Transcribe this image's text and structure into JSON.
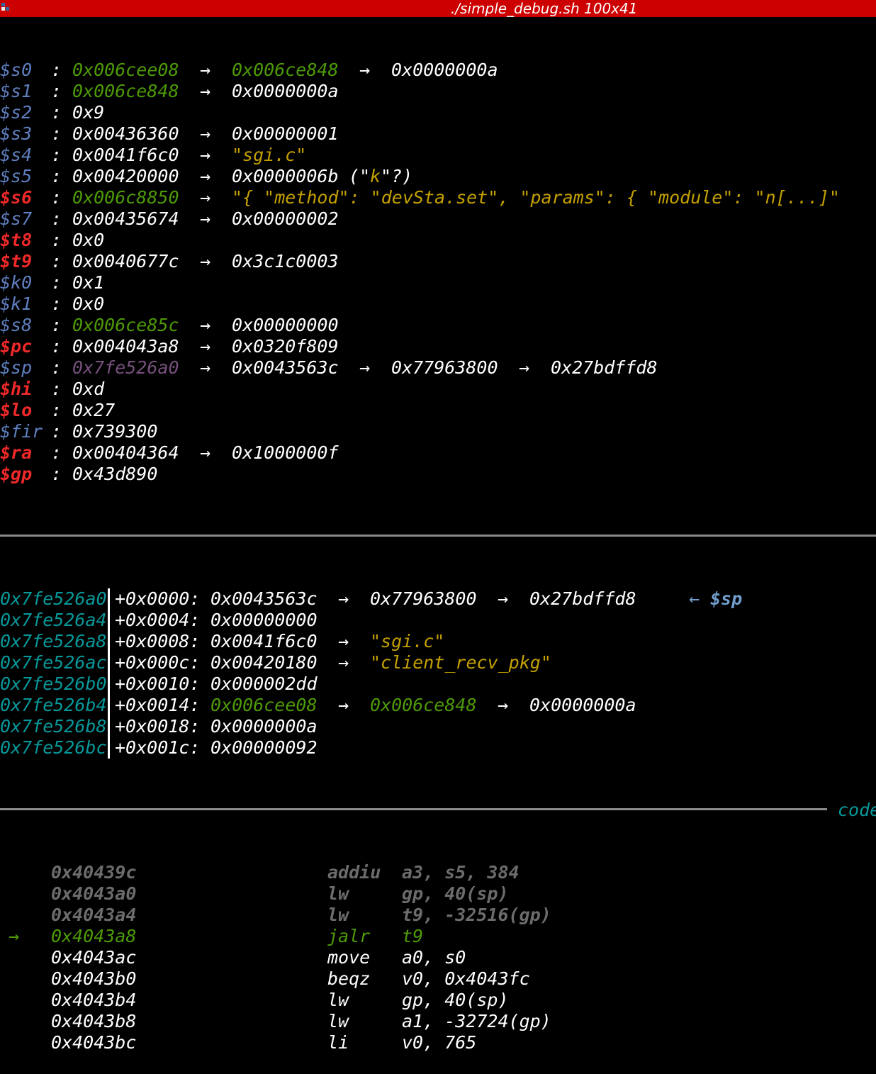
{
  "window": {
    "title": "./simple_debug.sh 100x41"
  },
  "colors": {
    "titlebar": "#cc0000",
    "reg_normal": "#5f7fbf",
    "reg_changed": "#ef2929",
    "value_white": "#ffffff",
    "value_heap": "#4e9a06",
    "value_stack": "#75507b",
    "string": "#c4a000",
    "stack_addr": "#06989a",
    "sep_line": "#8a8a8a",
    "code_past": "#6c6c6c",
    "code_current": "#4e9a06",
    "sp_marker": "#729fcf"
  },
  "registers": [
    {
      "name": "$s0",
      "changed": false,
      "chain": [
        {
          "text": "0x006cee08",
          "color": "heap"
        },
        {
          "text": "0x006ce848",
          "color": "heap"
        },
        {
          "text": "0x0000000a",
          "color": "white"
        }
      ]
    },
    {
      "name": "$s1",
      "changed": false,
      "chain": [
        {
          "text": "0x006ce848",
          "color": "heap"
        },
        {
          "text": "0x0000000a",
          "color": "white"
        }
      ]
    },
    {
      "name": "$s2",
      "changed": false,
      "chain": [
        {
          "text": "0x9",
          "color": "white"
        }
      ]
    },
    {
      "name": "$s3",
      "changed": false,
      "chain": [
        {
          "text": "0x00436360",
          "color": "white"
        },
        {
          "text": "0x00000001",
          "color": "white"
        }
      ]
    },
    {
      "name": "$s4",
      "changed": false,
      "chain": [
        {
          "text": "0x0041f6c0",
          "color": "white"
        },
        {
          "text": "\"sgi.c\"",
          "color": "string"
        }
      ]
    },
    {
      "name": "$s5",
      "changed": false,
      "chain": [
        {
          "text": "0x00420000",
          "color": "white"
        },
        {
          "text": "0x0000006b",
          "color": "white"
        }
      ],
      "suffix": [
        {
          "text": " (\"",
          "color": "white"
        },
        {
          "text": "k",
          "color": "string"
        },
        {
          "text": "\"?)",
          "color": "white"
        }
      ]
    },
    {
      "name": "$s6",
      "changed": true,
      "chain": [
        {
          "text": "0x006c8850",
          "color": "heap"
        },
        {
          "text": "\"{ \"method\": \"devSta.set\", \"params\": { \"module\": \"n[...]\"",
          "color": "string"
        }
      ]
    },
    {
      "name": "$s7",
      "changed": false,
      "chain": [
        {
          "text": "0x00435674",
          "color": "white"
        },
        {
          "text": "0x00000002",
          "color": "white"
        }
      ]
    },
    {
      "name": "$t8",
      "changed": true,
      "chain": [
        {
          "text": "0x0",
          "color": "white"
        }
      ]
    },
    {
      "name": "$t9",
      "changed": true,
      "chain": [
        {
          "text": "0x0040677c",
          "color": "white"
        },
        {
          "text": "0x3c1c0003",
          "color": "white"
        }
      ]
    },
    {
      "name": "$k0",
      "changed": false,
      "chain": [
        {
          "text": "0x1",
          "color": "white"
        }
      ]
    },
    {
      "name": "$k1",
      "changed": false,
      "chain": [
        {
          "text": "0x0",
          "color": "white"
        }
      ]
    },
    {
      "name": "$s8",
      "changed": false,
      "chain": [
        {
          "text": "0x006ce85c",
          "color": "heap"
        },
        {
          "text": "0x00000000",
          "color": "white"
        }
      ]
    },
    {
      "name": "$pc",
      "changed": true,
      "chain": [
        {
          "text": "0x004043a8",
          "color": "white"
        },
        {
          "text": "0x0320f809",
          "color": "white"
        }
      ]
    },
    {
      "name": "$sp",
      "changed": false,
      "chain": [
        {
          "text": "0x7fe526a0",
          "color": "stack"
        },
        {
          "text": "0x0043563c",
          "color": "white"
        },
        {
          "text": "0x77963800",
          "color": "white"
        },
        {
          "text": "0x27bdffd8",
          "color": "white"
        }
      ]
    },
    {
      "name": "$hi",
      "changed": true,
      "chain": [
        {
          "text": "0xd",
          "color": "white"
        }
      ]
    },
    {
      "name": "$lo",
      "changed": true,
      "chain": [
        {
          "text": "0x27",
          "color": "white"
        }
      ]
    },
    {
      "name": "$fir",
      "changed": false,
      "chain": [
        {
          "text": "0x739300",
          "color": "white"
        }
      ]
    },
    {
      "name": "$ra",
      "changed": true,
      "chain": [
        {
          "text": "0x00404364",
          "color": "white"
        },
        {
          "text": "0x1000000f",
          "color": "white"
        }
      ]
    },
    {
      "name": "$gp",
      "changed": true,
      "chain": [
        {
          "text": "0x43d890",
          "color": "white"
        }
      ]
    }
  ],
  "symbols": {
    "arrow": "→",
    "sep": ":",
    "back_arrow": "←"
  },
  "stack": {
    "rows": [
      {
        "addr": "0x7fe526a0",
        "offset": "+0x0000:",
        "chain": [
          {
            "text": "0x0043563c",
            "color": "white"
          },
          {
            "text": "0x77963800",
            "color": "white"
          },
          {
            "text": "0x27bdffd8",
            "color": "white"
          }
        ],
        "marker": "$sp"
      },
      {
        "addr": "0x7fe526a4",
        "offset": "+0x0004:",
        "chain": [
          {
            "text": "0x00000000",
            "color": "white"
          }
        ]
      },
      {
        "addr": "0x7fe526a8",
        "offset": "+0x0008:",
        "chain": [
          {
            "text": "0x0041f6c0",
            "color": "white"
          },
          {
            "text": "\"sgi.c\"",
            "color": "string"
          }
        ]
      },
      {
        "addr": "0x7fe526ac",
        "offset": "+0x000c:",
        "chain": [
          {
            "text": "0x00420180",
            "color": "white"
          },
          {
            "text": "\"client_recv_pkg\"",
            "color": "string"
          }
        ]
      },
      {
        "addr": "0x7fe526b0",
        "offset": "+0x0010:",
        "chain": [
          {
            "text": "0x000002dd",
            "color": "white"
          }
        ]
      },
      {
        "addr": "0x7fe526b4",
        "offset": "+0x0014:",
        "chain": [
          {
            "text": "0x006cee08",
            "color": "heap"
          },
          {
            "text": "0x006ce848",
            "color": "heap"
          },
          {
            "text": "0x0000000a",
            "color": "white"
          }
        ]
      },
      {
        "addr": "0x7fe526b8",
        "offset": "+0x0018:",
        "chain": [
          {
            "text": "0x0000000a",
            "color": "white"
          }
        ]
      },
      {
        "addr": "0x7fe526bc",
        "offset": "+0x001c:",
        "chain": [
          {
            "text": "0x00000092",
            "color": "white"
          }
        ]
      }
    ]
  },
  "code": {
    "section_label": "code",
    "current_marker": "→",
    "rows": [
      {
        "addr": "0x40439c",
        "mnemonic": "addiu",
        "operands": "a3, s5, 384",
        "state": "past"
      },
      {
        "addr": "0x4043a0",
        "mnemonic": "lw",
        "operands": "gp, 40(sp)",
        "state": "past"
      },
      {
        "addr": "0x4043a4",
        "mnemonic": "lw",
        "operands": "t9, -32516(gp)",
        "state": "past"
      },
      {
        "addr": "0x4043a8",
        "mnemonic": "jalr",
        "operands": "t9",
        "state": "current"
      },
      {
        "addr": "0x4043ac",
        "mnemonic": "move",
        "operands": "a0, s0",
        "state": "future"
      },
      {
        "addr": "0x4043b0",
        "mnemonic": "beqz",
        "operands": "v0, 0x4043fc",
        "state": "future"
      },
      {
        "addr": "0x4043b4",
        "mnemonic": "lw",
        "operands": "gp, 40(sp)",
        "state": "future"
      },
      {
        "addr": "0x4043b8",
        "mnemonic": "lw",
        "operands": "a1, -32724(gp)",
        "state": "future"
      },
      {
        "addr": "0x4043bc",
        "mnemonic": "li",
        "operands": "v0, 765",
        "state": "future"
      }
    ]
  }
}
